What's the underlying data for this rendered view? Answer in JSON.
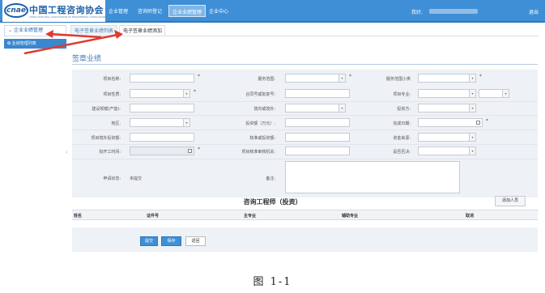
{
  "header": {
    "logo_mark": "cnae",
    "logo_text": "中国工程咨询协会",
    "logo_sub": "CHINA NATIONAL ASSOCIATION OF ENGINEERING CONSULTANTS",
    "nav": [
      {
        "label": "企业管理"
      },
      {
        "label": "咨询师登记"
      },
      {
        "label": "企业业绩管理"
      },
      {
        "label": "企业中心"
      }
    ],
    "user_prefix": "我好,",
    "logout": "退出"
  },
  "sidebar": {
    "header": "企业业绩管理",
    "item": "业绩管理列表"
  },
  "tabs": [
    {
      "label": "电子签章业绩列表"
    },
    {
      "label": "电子签章业绩添加"
    }
  ],
  "form": {
    "title": "签章业绩",
    "fields": {
      "project_name": "项目名称:",
      "service_scope": "服务范围:",
      "service_scope_sub": "服务范围小类",
      "project_nature": "项目性质:",
      "contract_no": "合同号或批复号:",
      "project_major": "项目专业:",
      "scale": "建设规模(产能):",
      "domestic_fund": "境内或境外:",
      "investor": "投资方:",
      "region": "地区:",
      "investment": "投资额（万元）:",
      "finish_date": "完成日期:",
      "overseas_investment": "项目境外投资额:",
      "approved_investment": "核准或投资额:",
      "fund_source": "资金来源:",
      "start_date": "拟开工时间:",
      "approval_org": "项目核准审核机关:",
      "is_rejected": "是否否决:",
      "apply_status": "申请状态:",
      "apply_status_value": "未提交",
      "remark": "备注:"
    },
    "required_mark": "*"
  },
  "consultants": {
    "title": "咨询工程师（投资）",
    "add_button": "添加人员",
    "columns": [
      "姓名",
      "证件号",
      "主专业",
      "辅助专业",
      "取消"
    ]
  },
  "actions": {
    "submit": "提交",
    "save": "保存",
    "back": "返回"
  },
  "caption": "图 1-1",
  "colors": {
    "header_blue": "#3f8fd6",
    "annotation_red": "#e03a2f"
  }
}
